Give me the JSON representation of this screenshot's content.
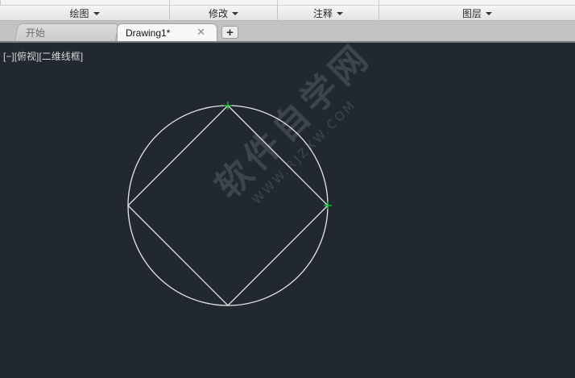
{
  "ribbon": {
    "panels": [
      {
        "label": "绘图"
      },
      {
        "label": "修改"
      },
      {
        "label": "注释"
      },
      {
        "label": "图层"
      }
    ]
  },
  "tabs": {
    "start_label": "开始",
    "drawing_label": "Drawing1*",
    "close_glyph": "✕",
    "new_tab_glyph": "+"
  },
  "viewport": {
    "control": "[−]",
    "view": "[俯视]",
    "visual_style": "[二维线框]"
  },
  "watermark": {
    "text": "软件自学网",
    "url": "WWW.RJZXW.COM"
  },
  "colors": {
    "canvas_bg": "#212830",
    "geometry": "#e8e8e8",
    "grip": "#19c23a"
  }
}
